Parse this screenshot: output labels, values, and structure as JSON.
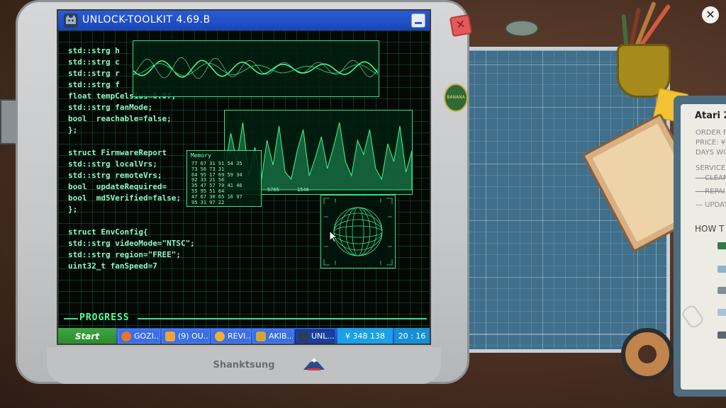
{
  "window": {
    "title": "UNLOCK-TOOLKIT 4.69.B"
  },
  "code": [
    "std::strg h",
    "std::strg c",
    "std::strg r",
    "std::strg f",
    "float tempCelsius=0.0f;",
    "std::strg fanMode;",
    "bool  reachable=false;",
    "};",
    "",
    "struct FirmwareReport",
    "std::strg localVrs;",
    "std::strg remoteVrs;",
    "bool  updateRequired=",
    "bool  md5Verified=false;",
    "};",
    "",
    "struct EnvConfig{",
    "std::strg videoMode=\"NTSC\";",
    "std::strg region=\"FREE\";",
    "uint32_t fanSpeed=7"
  ],
  "memory_panel": {
    "label": "Memory",
    "rows": [
      "77 67 31 91 54 35",
      "73 56 73 31",
      "64 95 17 69 59 34",
      "92 33 21 56",
      "35 47 57 70 41 46",
      "55 95 51 64",
      "47 67 30 65 16 97",
      "95 31 97 22"
    ]
  },
  "bar_panel": {
    "axis_labels": [
      "5765",
      "1546"
    ]
  },
  "progress": {
    "label": "PROGRESS",
    "value": 0.98
  },
  "taskbar": {
    "start_label": "Start",
    "items": [
      {
        "label": "GOZI...",
        "icon": "browser-icon"
      },
      {
        "label": "(9)  OU...",
        "icon": "mail-icon"
      },
      {
        "label": "REVI...",
        "icon": "review-icon"
      },
      {
        "label": "AKIB...",
        "icon": "trophy-icon"
      },
      {
        "label": "UNL...",
        "icon": "cat-app-icon"
      }
    ],
    "money": "¥ 348 138",
    "clock": "20 : 16"
  },
  "monitor": {
    "brand": "Shanktsung"
  },
  "badge": {
    "text": "BANANA"
  },
  "order_card": {
    "title": "Atari 2",
    "lines": [
      "ORDER F",
      "PRICE: ¥",
      "DAYS WO",
      "SERVICE",
      "— CLEAN",
      "— REPAI",
      "— UPDAT"
    ],
    "howto": "HOW T"
  },
  "colors": {
    "screen_green": "#38e08a",
    "titlebar_blue": "#2a5bd7",
    "start_green": "#2a8a2c"
  }
}
